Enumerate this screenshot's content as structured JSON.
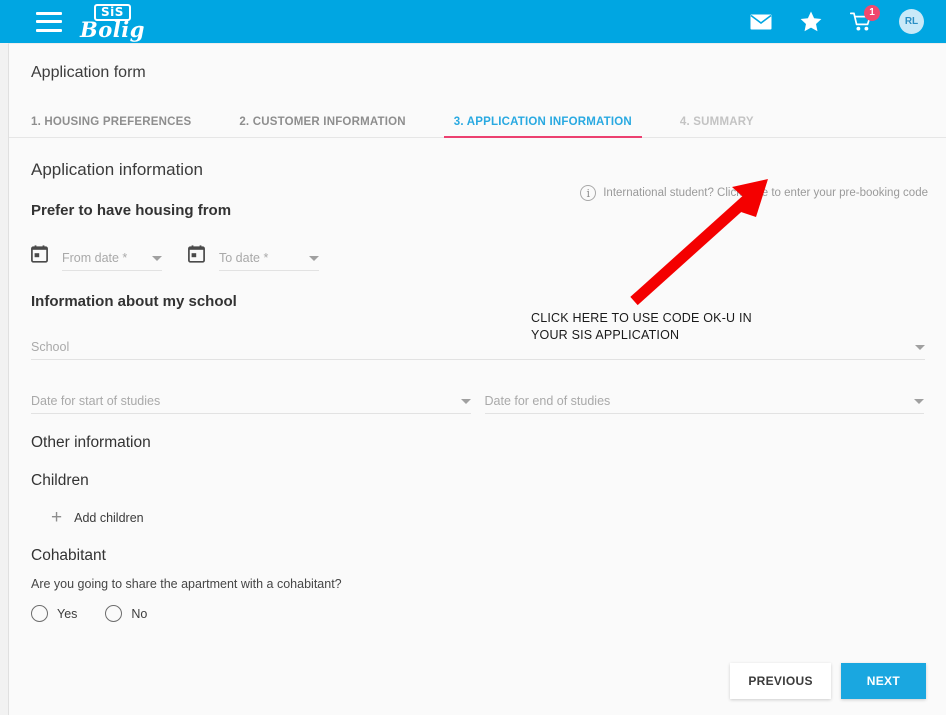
{
  "appbar": {
    "menu_icon": "hamburger-icon",
    "logo_top": "SiS",
    "logo_bottom": "Bolig",
    "icons": {
      "mail": "mail-icon",
      "favorite": "star-icon",
      "cart": "cart-icon",
      "cart_badge": "1",
      "avatar_initials": "RL"
    }
  },
  "page": {
    "title": "Application form",
    "tabs": [
      {
        "label": "1. HOUSING PREFERENCES",
        "state": "inactive"
      },
      {
        "label": "2. CUSTOMER INFORMATION",
        "state": "inactive"
      },
      {
        "label": "3. APPLICATION INFORMATION",
        "state": "active"
      },
      {
        "label": "4. SUMMARY",
        "state": "dim"
      }
    ]
  },
  "main": {
    "heading": "Application information",
    "info_link": "International student? Click here to enter your pre-booking code",
    "housing": {
      "heading": "Prefer to have housing from",
      "from_placeholder": "From date *",
      "to_placeholder": "To date *"
    },
    "school": {
      "heading": "Information about my school",
      "school_placeholder": "School",
      "start_placeholder": "Date for start of studies",
      "end_placeholder": "Date for end of studies"
    },
    "other": {
      "heading": "Other information",
      "children_heading": "Children",
      "add_children_label": "Add children",
      "cohabitant_heading": "Cohabitant",
      "cohabitant_question": "Are you going to share the apartment with a cohabitant?",
      "radio_yes": "Yes",
      "radio_no": "No"
    }
  },
  "footer": {
    "previous_label": "PREVIOUS",
    "next_label": "NEXT"
  },
  "annotation": {
    "text": "CLICK HERE TO USE CODE OK-U IN\nYOUR SIS APPLICATION",
    "color": "#f40000"
  },
  "colors": {
    "brand_blue": "#00a6e2",
    "accent_pink": "#ec4070",
    "tab_active": "#29a9e1",
    "button_next": "#1aa7e0",
    "badge": "#f0486e",
    "annotation_red": "#f40000"
  }
}
